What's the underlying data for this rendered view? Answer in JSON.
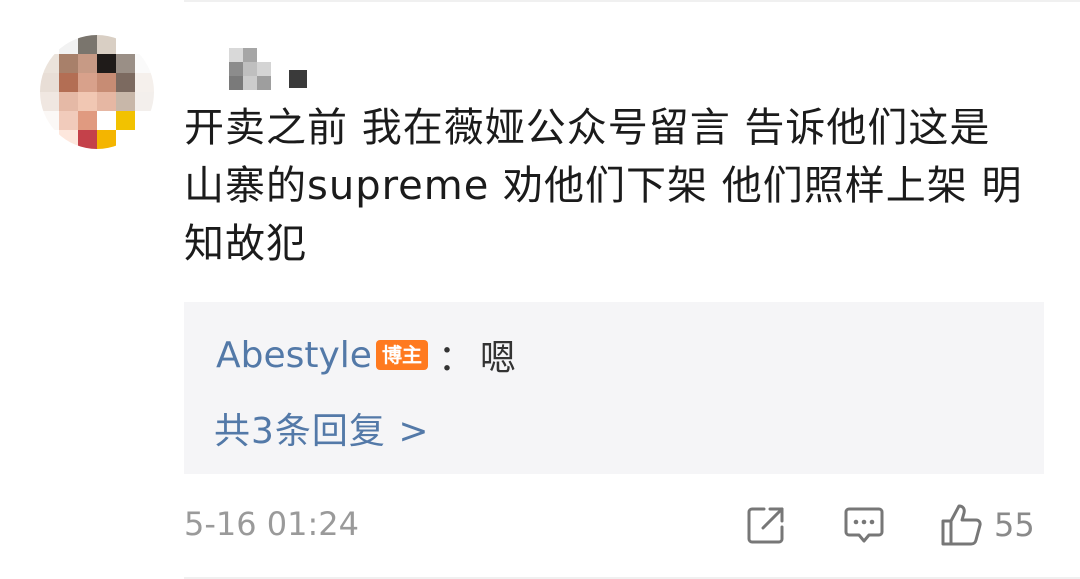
{
  "comment": {
    "text": "开卖之前 我在薇娅公众号留言 告诉他们这是山寨的supreme 劝他们下架 他们照样上架 明知故犯",
    "timestamp": "5-16 01:24",
    "like_count": "55"
  },
  "reply": {
    "author": "Abestyle",
    "badge": "博主",
    "separator": "：",
    "content": "嗯",
    "view_all": "共3条回复 >"
  },
  "colors": {
    "link_blue": "#5379a8",
    "badge_orange": "#ff7a1f",
    "text_primary": "#1b1b1b",
    "meta_gray": "#9a9a9a",
    "reply_bg": "#f5f5f7"
  },
  "icons": {
    "share": "share-icon",
    "comment": "comment-icon",
    "like": "thumbs-up-icon"
  }
}
